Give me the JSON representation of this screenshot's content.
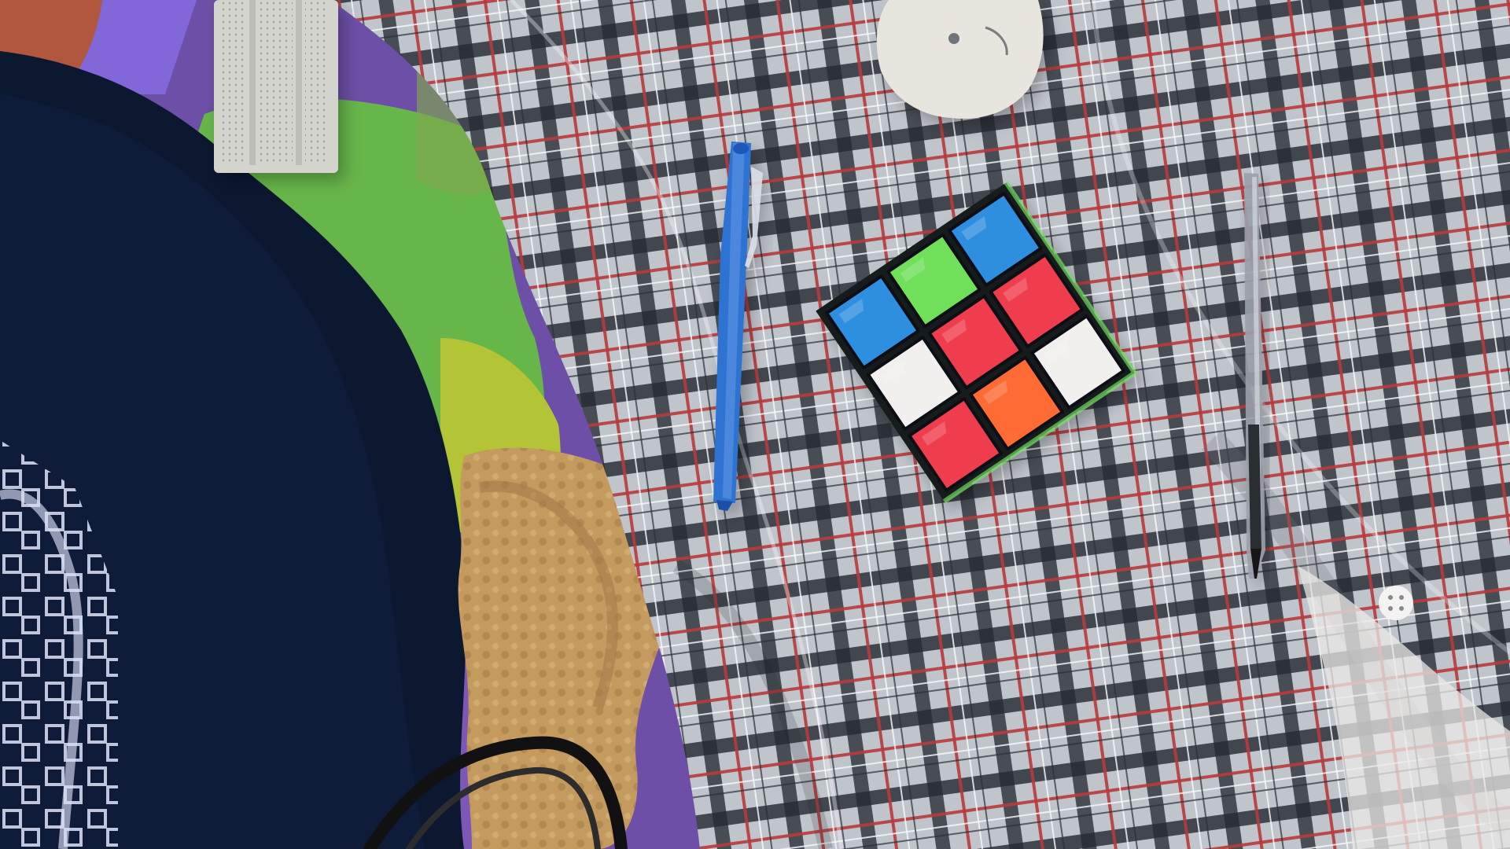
{
  "scene": {
    "description_label": "",
    "colors": {
      "bedspread_purple": "#6d4fa7",
      "bedspread_green": "#67b64a",
      "bedspread_yellow": "#b4c437",
      "blanket_navy": "#0c1730",
      "blanket_pattern": "#d7ddf2",
      "fleece_tan": "#c49a5f",
      "shirt_base": "#c9ccd2",
      "shirt_dark": "#242a33",
      "shirt_red": "#b73a3c",
      "pen_blue": "#2f73d1",
      "pencil_grey": "#9aa0aa",
      "earbuds_case": "#e8e5df",
      "breadboard": "#d4d4cf",
      "cube_body": "#171a1f"
    },
    "cube": {
      "face_colors": [
        [
          "#2f8fe0",
          "#6fe05a",
          "#2f8fe0"
        ],
        [
          "#f2f0ee",
          "#ef3e4d",
          "#ef3e4d"
        ],
        [
          "#ef3e4d",
          "#ff6a35",
          "#f2f0ee"
        ]
      ]
    },
    "objects": [
      "blanket",
      "bedspread",
      "fleece",
      "plaid-shirt",
      "blue-pen",
      "mechanical-pencil",
      "earbuds-case",
      "breadboard",
      "rubiks-cube",
      "shirt-button",
      "cable"
    ]
  }
}
